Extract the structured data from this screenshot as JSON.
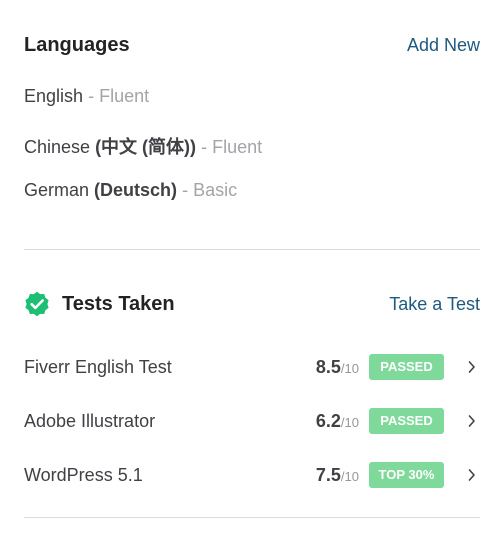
{
  "languages": {
    "title": "Languages",
    "add_label": "Add New",
    "items": [
      {
        "name": "English",
        "native": "",
        "separator": "-",
        "level": "Fluent"
      },
      {
        "name": "Chinese",
        "native": "(中文 (简体))",
        "separator": "-",
        "level": "Fluent"
      },
      {
        "name": "German",
        "native": "(Deutsch)",
        "separator": "-",
        "level": "Basic"
      }
    ]
  },
  "tests": {
    "title": "Tests Taken",
    "take_label": "Take a Test",
    "max_label": "/10",
    "items": [
      {
        "name": "Fiverr English Test",
        "score": "8.5",
        "badge": "PASSED"
      },
      {
        "name": "Adobe Illustrator",
        "score": "6.2",
        "badge": "PASSED"
      },
      {
        "name": "WordPress 5.1",
        "score": "7.5",
        "badge": "TOP 30%"
      }
    ]
  },
  "icons": {
    "verified": "verified-check-icon",
    "row_arrow": "chevron-right-icon"
  },
  "colors": {
    "title": "#222325",
    "text": "#404145",
    "muted": "#a3a4a8",
    "link": "#1d5a7e",
    "badge_bg": "#7fd99a",
    "verified_green": "#1dbf73",
    "divider": "#dadbdd"
  }
}
